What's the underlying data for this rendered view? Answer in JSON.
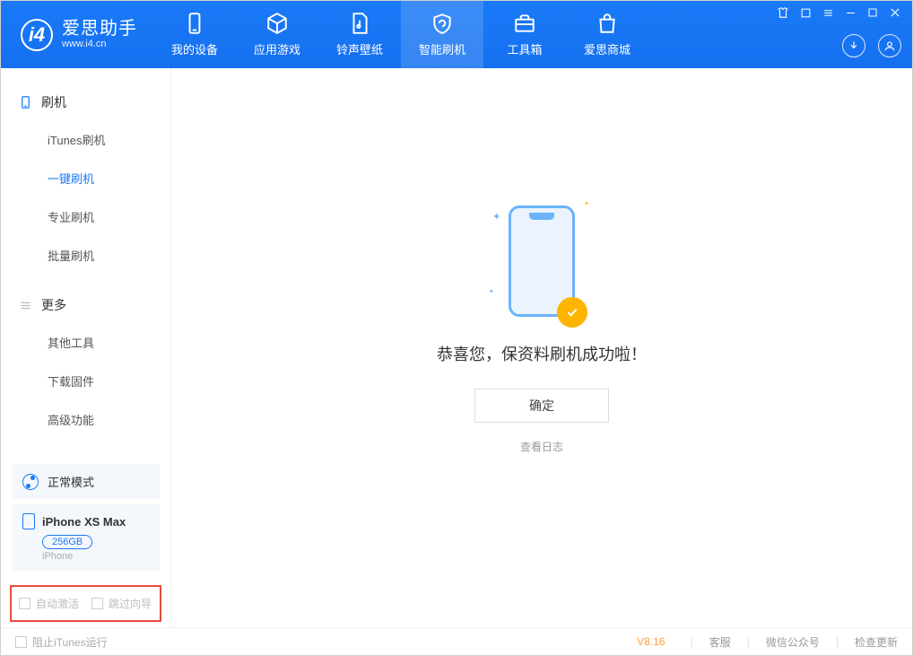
{
  "app": {
    "title": "爱思助手",
    "url": "www.i4.cn"
  },
  "nav": {
    "tabs": [
      {
        "label": "我的设备"
      },
      {
        "label": "应用游戏"
      },
      {
        "label": "铃声壁纸"
      },
      {
        "label": "智能刷机"
      },
      {
        "label": "工具箱"
      },
      {
        "label": "爱思商城"
      }
    ]
  },
  "sidebar": {
    "section1_title": "刷机",
    "items1": [
      {
        "label": "iTunes刷机"
      },
      {
        "label": "一键刷机"
      },
      {
        "label": "专业刷机"
      },
      {
        "label": "批量刷机"
      }
    ],
    "section2_title": "更多",
    "items2": [
      {
        "label": "其他工具"
      },
      {
        "label": "下载固件"
      },
      {
        "label": "高级功能"
      }
    ],
    "mode_label": "正常模式",
    "device_name": "iPhone XS Max",
    "storage": "256GB",
    "device_type": "iPhone",
    "checkbox1": "自动激活",
    "checkbox2": "跳过向导"
  },
  "main": {
    "success_text": "恭喜您，保资料刷机成功啦！",
    "ok_button": "确定",
    "log_link": "查看日志"
  },
  "footer": {
    "block_itunes": "阻止iTunes运行",
    "version": "V8.16",
    "link1": "客服",
    "link2": "微信公众号",
    "link3": "检查更新"
  }
}
